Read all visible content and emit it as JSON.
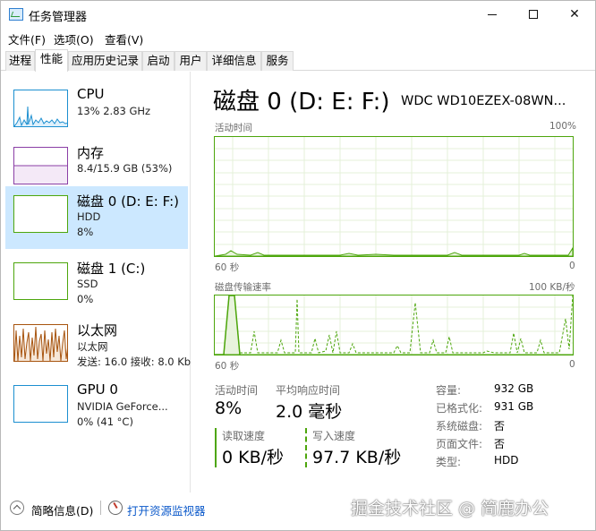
{
  "window": {
    "title": "任务管理器"
  },
  "menu": [
    {
      "label": "文件(F)"
    },
    {
      "label": "选项(O)"
    },
    {
      "label": "查看(V)"
    }
  ],
  "tabs": [
    {
      "label": "进程"
    },
    {
      "label": "性能"
    },
    {
      "label": "应用历史记录"
    },
    {
      "label": "启动"
    },
    {
      "label": "用户"
    },
    {
      "label": "详细信息"
    },
    {
      "label": "服务"
    }
  ],
  "resources": [
    {
      "name": "CPU",
      "line1": "13% 2.83 GHz",
      "line2": ""
    },
    {
      "name": "内存",
      "line1": "8.4/15.9 GB (53%)",
      "line2": ""
    },
    {
      "name": "磁盘 0 (D: E: F:)",
      "line1": "HDD",
      "line2": "8%"
    },
    {
      "name": "磁盘 1 (C:)",
      "line1": "SSD",
      "line2": "0%"
    },
    {
      "name": "以太网",
      "line1": "以太网",
      "line2": "发送: 16.0 接收: 8.0 Kb"
    },
    {
      "name": "GPU 0",
      "line1": "NVIDIA GeForce...",
      "line2": "0% (41 °C)"
    }
  ],
  "detail": {
    "title": "磁盘 0 (D: E: F:)",
    "model": "WDC WD10EZEX-08WN...",
    "graph1": {
      "label": "活动时间",
      "max": "100%",
      "time": "60 秒",
      "zero": "0"
    },
    "graph2": {
      "label": "磁盘传输速率",
      "max": "100 KB/秒",
      "time": "60 秒",
      "zero": "0"
    },
    "stats": {
      "active_label": "活动时间",
      "active_value": "8%",
      "response_label": "平均响应时间",
      "response_value": "2.0 毫秒",
      "read_label": "读取速度",
      "read_value": "0 KB/秒",
      "write_label": "写入速度",
      "write_value": "97.7 KB/秒"
    },
    "props": [
      {
        "key": "容量:",
        "value": "932 GB"
      },
      {
        "key": "已格式化:",
        "value": "931 GB"
      },
      {
        "key": "系统磁盘:",
        "value": "否"
      },
      {
        "key": "页面文件:",
        "value": "否"
      },
      {
        "key": "类型:",
        "value": "HDD"
      }
    ]
  },
  "bottom": {
    "brief": "简略信息(D)",
    "monitor": "打开资源监视器",
    "watermark": "掘金技术社区 @ 简鹿办公"
  },
  "colors": {
    "disk": "#4da60c",
    "cpu": "#1c8fd0",
    "memory": "#8b3fa6",
    "ethernet": "#a7540f",
    "gpu": "#1c8fd0",
    "selected": "#cce8ff"
  }
}
